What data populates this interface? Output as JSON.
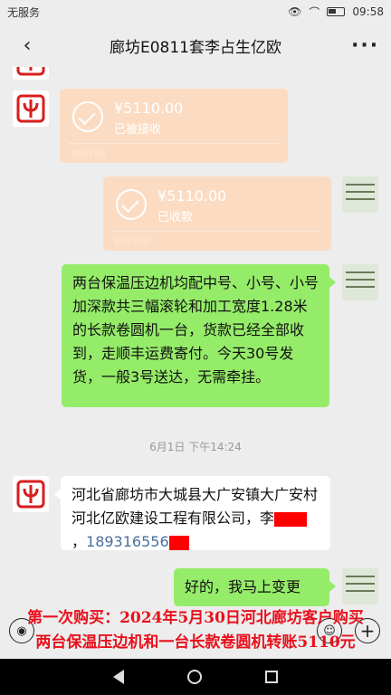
{
  "status": {
    "carrier": "无服务",
    "time": "09:58"
  },
  "header": {
    "title": "廊坊E0811套李占生亿欧",
    "back": "‹",
    "more": "···"
  },
  "messages": {
    "transfer1": {
      "amount": "¥5110.00",
      "state": "已被接收",
      "brand": "微信转账"
    },
    "transfer2": {
      "amount": "¥5110.00",
      "state": "已收款",
      "brand": "微信转账"
    },
    "text1": "两台保温压边机均配中号、小号、小号加深款共三幅滚轮和加工宽度1.28米的长款卷圆机一台，货款已经全部收到，走顺丰运费寄付。今天30号发货，一般3号送达，无需牵挂。",
    "timestamp": "6月1日 下午14:24",
    "text2_line1": "河北省廊坊市大城县大广安镇大广安村河北亿欧建设工程有限公司，",
    "text2_name": "李",
    "text2_sep": "，",
    "text2_phone": "189316556",
    "text3": "好的，我马上变更"
  },
  "caption": {
    "line1": "第一次购买：2024年5月30日河北廊坊客户购买",
    "line2": "两台保温压边机和一台长款卷圆机转账5110元"
  },
  "colors": {
    "green_bubble": "#95ec69",
    "transfer": "#fbdcc3",
    "caption": "#e8101c",
    "redaction": "#ff0000"
  }
}
